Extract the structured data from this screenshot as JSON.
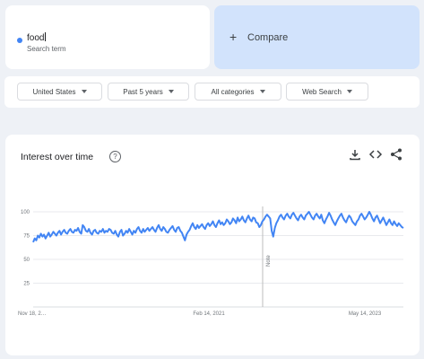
{
  "search_term": {
    "name": "food",
    "subtitle": "Search term",
    "color": "#4285f4"
  },
  "compare": {
    "label": "Compare",
    "icon": "plus-icon"
  },
  "filters": [
    {
      "label": "United States"
    },
    {
      "label": "Past 5 years"
    },
    {
      "label": "All categories"
    },
    {
      "label": "Web Search"
    }
  ],
  "chart_panel": {
    "title": "Interest over time",
    "icons": [
      "help-icon",
      "download-icon",
      "embed-icon",
      "share-icon"
    ],
    "note_label": "Note"
  },
  "chart_data": {
    "type": "line",
    "title": "Interest over time",
    "ylim": [
      0,
      100
    ],
    "yticks": [
      25,
      50,
      75,
      100
    ],
    "x_tick_labels": [
      "Nov 18, 2…",
      "Feb 14, 2021",
      "May 14, 2023"
    ],
    "grid": true,
    "line_color": "#4285f4",
    "series": [
      {
        "values": [
          68,
          72,
          70,
          75,
          73,
          77,
          74,
          76,
          72,
          75,
          78,
          74,
          76,
          79,
          77,
          75,
          78,
          80,
          76,
          79,
          81,
          78,
          77,
          80,
          82,
          79,
          78,
          81,
          80,
          83,
          79,
          77,
          86,
          84,
          80,
          79,
          82,
          78,
          76,
          80,
          81,
          78,
          77,
          80,
          79,
          82,
          78,
          80,
          79,
          82,
          81,
          78,
          77,
          80,
          76,
          74,
          79,
          81,
          75,
          77,
          80,
          78,
          82,
          79,
          76,
          80,
          78,
          82,
          84,
          80,
          78,
          82,
          79,
          81,
          83,
          80,
          82,
          84,
          81,
          79,
          83,
          86,
          82,
          80,
          84,
          82,
          79,
          78,
          81,
          83,
          85,
          81,
          79,
          83,
          84,
          80,
          78,
          74,
          70,
          76,
          79,
          81,
          85,
          88,
          84,
          82,
          86,
          83,
          85,
          87,
          84,
          82,
          86,
          88,
          85,
          87,
          90,
          86,
          84,
          88,
          91,
          87,
          89,
          86,
          88,
          92,
          90,
          87,
          89,
          93,
          91,
          88,
          94,
          90,
          92,
          95,
          91,
          89,
          93,
          96,
          92,
          90,
          94,
          93,
          89,
          88,
          84,
          86,
          90,
          92,
          95,
          97,
          95,
          93,
          80,
          74,
          83,
          88,
          91,
          95,
          97,
          94,
          92,
          96,
          98,
          95,
          93,
          97,
          99,
          96,
          93,
          91,
          95,
          97,
          94,
          92,
          96,
          98,
          100,
          97,
          94,
          92,
          96,
          98,
          95,
          93,
          97,
          91,
          88,
          92,
          95,
          99,
          96,
          92,
          89,
          86,
          90,
          93,
          96,
          98,
          94,
          91,
          89,
          93,
          96,
          94,
          90,
          88,
          86,
          90,
          92,
          96,
          98,
          95,
          92,
          94,
          97,
          100,
          97,
          93,
          90,
          94,
          96,
          92,
          88,
          91,
          94,
          90,
          86,
          89,
          92,
          88,
          86,
          90,
          87,
          85,
          88,
          86,
          84,
          83
        ]
      }
    ]
  }
}
